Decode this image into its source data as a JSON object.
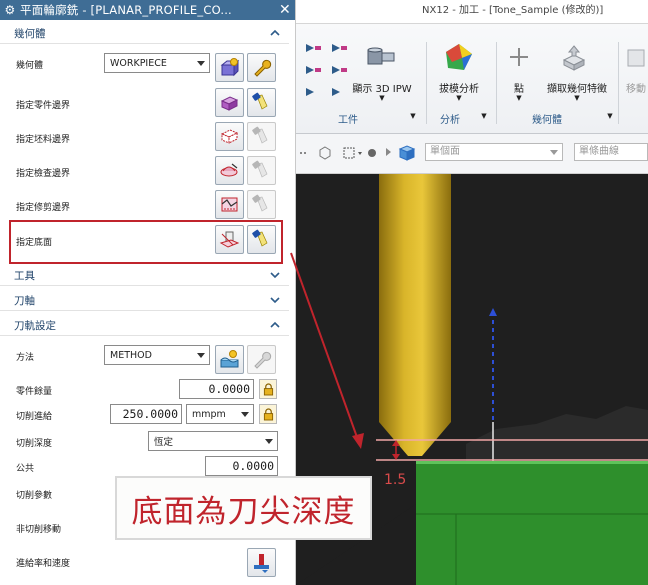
{
  "dialog": {
    "title": "平面輪廓銑 - [PLANAR_PROFILE_CO...",
    "sections": {
      "geometry": "幾何體",
      "tool": "工具",
      "tool_axis": "刀軸",
      "path_settings": "刀軌設定"
    },
    "geometry": {
      "label": "幾何體",
      "value": "WORKPIECE",
      "specify_part_boundary": "指定零件邊界",
      "specify_blank_boundary": "指定坯料邊界",
      "specify_check_boundary": "指定檢查邊界",
      "specify_trim_boundary": "指定修剪邊界",
      "specify_floor": "指定底面"
    },
    "path": {
      "method_label": "方法",
      "method_value": "METHOD",
      "part_stock_label": "零件餘量",
      "part_stock_value": "0.0000",
      "feed_label": "切削進給",
      "feed_value": "250.0000",
      "feed_unit": "mmpm",
      "depth_label": "切削深度",
      "depth_value": "恆定",
      "common_label": "公共",
      "common_value": "0.0000",
      "cut_params_label": "切削參數",
      "non_cut_label": "非切削移動",
      "feeds_speeds_label": "進給率和速度"
    }
  },
  "ribbon": {
    "top_text": "NX12 - 加工 - [Tone_Sample (修改的)]",
    "buttons": {
      "show_3d_ipw": "顯示 3D IPW",
      "draft_analysis": "拔模分析",
      "point": "點",
      "extract_geometry": "擷取幾何特徵",
      "move": "移動"
    },
    "groups": {
      "workpiece": "工件",
      "analysis": "分析",
      "geometry": "幾何體"
    },
    "filters": {
      "face_filter": "單個面",
      "curve_filter": "單條曲線"
    }
  },
  "viewport": {
    "dimension": "1.5"
  },
  "callout": {
    "text": "底面為刀尖深度"
  },
  "colors": {
    "title_bar": "#3f6d95",
    "highlight_red": "#c0242c",
    "tool_gold": "#c9a519",
    "floor_green": "#2e8f2c"
  }
}
